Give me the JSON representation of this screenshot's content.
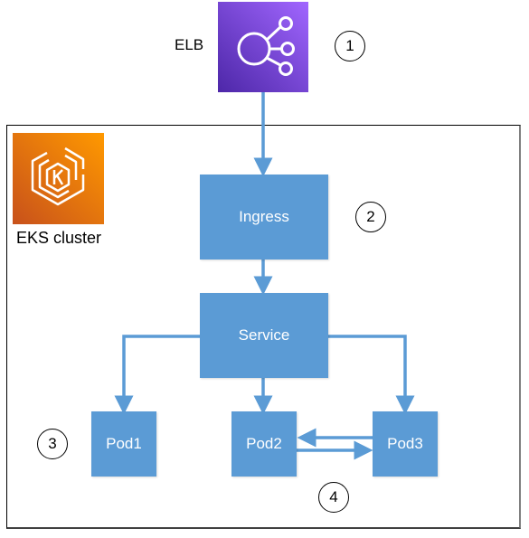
{
  "diagram": {
    "elb": {
      "label": "ELB",
      "icon": "elastic-load-balancer-icon",
      "color": "#8c4fff"
    },
    "cluster": {
      "label": "EKS cluster",
      "icon": "eks-icon",
      "color": "#ed7100"
    },
    "nodes": {
      "ingress": "Ingress",
      "service": "Service",
      "pod1": "Pod1",
      "pod2": "Pod2",
      "pod3": "Pod3"
    },
    "badges": [
      "1",
      "2",
      "3",
      "4"
    ],
    "box_color": "#5b9bd5",
    "arrow_color": "#5b9bd5",
    "edges": [
      {
        "from": "elb",
        "to": "ingress"
      },
      {
        "from": "ingress",
        "to": "service"
      },
      {
        "from": "service",
        "to": "pod1"
      },
      {
        "from": "service",
        "to": "pod2"
      },
      {
        "from": "service",
        "to": "pod3"
      },
      {
        "from": "pod3",
        "to": "pod2"
      },
      {
        "from": "pod2",
        "to": "pod3"
      }
    ]
  }
}
